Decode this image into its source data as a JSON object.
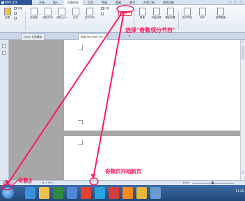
{
  "titlebar": {
    "app_label": "WPS 文字",
    "menu": [
      "开始",
      "插入",
      "页面布局",
      "引用",
      "审阅",
      "视图",
      "章节",
      "开发工具",
      "特色功能"
    ],
    "active_menu_index": 2
  },
  "ribbon": {
    "theme_label": "主题",
    "paper_label": "字体",
    "page_margin_label": "页边距",
    "orientation_label": "纸张方向",
    "size_label": "纸张大小",
    "columns_label": "分栏",
    "text_direction_label": "文字方向",
    "line_numbers_label": "行号",
    "breaks_label": "分隔符",
    "background_label": "背景",
    "page_border_label": "页面边框",
    "wrap_label": "稿纸设置",
    "text_wrap_label": "文字环绕",
    "align_label": "对齐",
    "select_pane_label": "选择窗格"
  },
  "tabs": {
    "items": [
      "Docer-在线模板",
      "新建 Microsoft Off..."
    ],
    "active_index": 1,
    "add_label": "+"
  },
  "statusbar": {
    "page_indicator": "页面: 1/3",
    "section": "节: 3/3",
    "row_col": "行: 1  列: 1",
    "zoom": "100%"
  },
  "annotations": {
    "callout_insert_section": "选择\"奇数项分节符\"",
    "callout_odd_page_new": "奇数页开始新页",
    "callout_odd_3": "奇数3"
  },
  "colors": {
    "annotation": "#ff1a5e",
    "ribbon_bg": "#e9eff7",
    "taskbar": "#2a558b"
  },
  "taskbar": {
    "icons": [
      "windows-start",
      "ie-icon",
      "folder-icon",
      "excel-icon",
      "wps-writer-icon",
      "browser-icon",
      "qq-icon",
      "wps-icon",
      "video-icon",
      "chrome-icon",
      "photo-icon"
    ],
    "tray_time": "11:28"
  }
}
